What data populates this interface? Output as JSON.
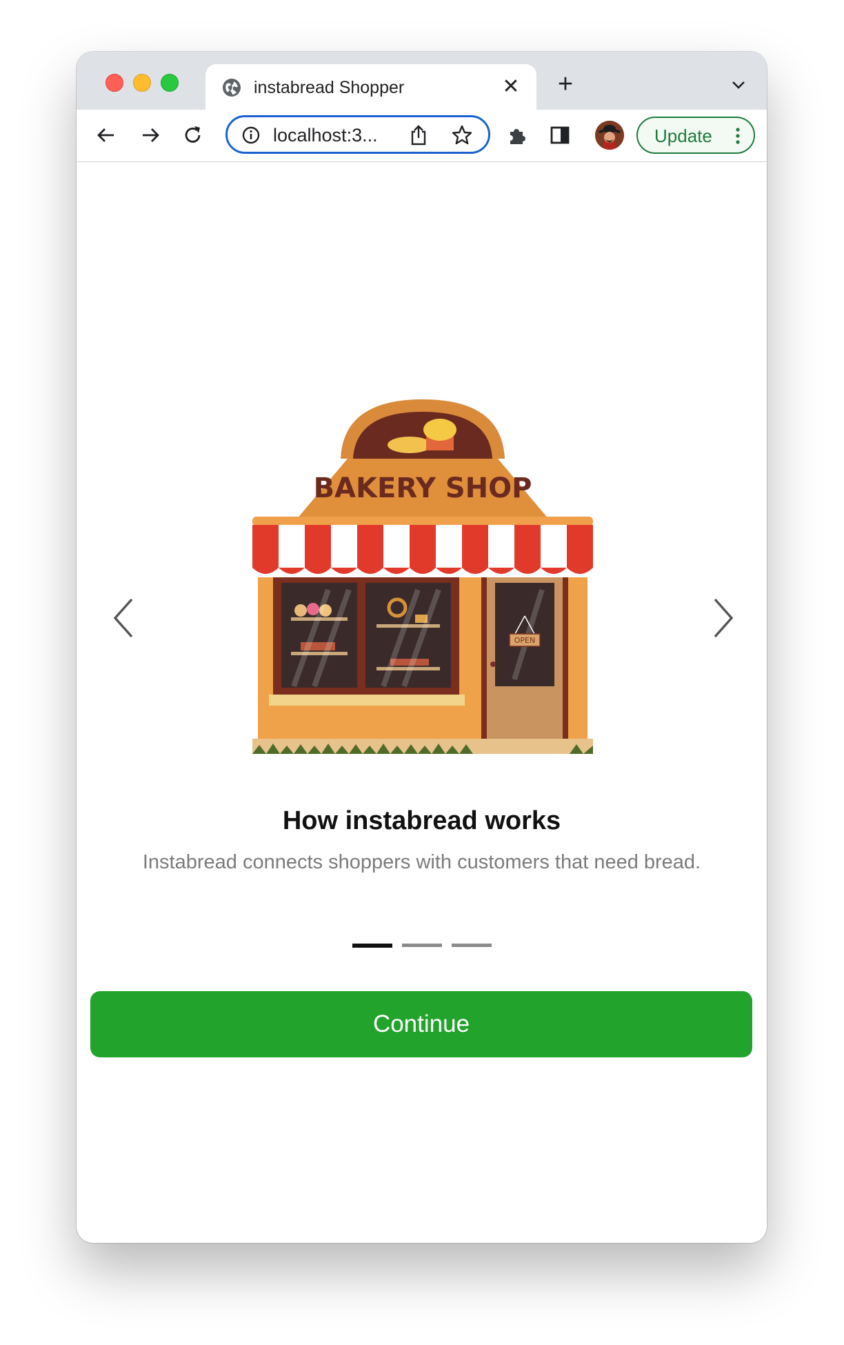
{
  "browser": {
    "tab": {
      "title": "instabread Shopper"
    },
    "address_bar": {
      "url": "localhost:3..."
    },
    "update_button": {
      "label": "Update"
    }
  },
  "onboarding": {
    "illustration": {
      "sign_text": "BAKERY SHOP",
      "door_sign": "OPEN"
    },
    "headline": "How instabread works",
    "description": "Instabread connects shoppers with customers that need bread.",
    "pagination": {
      "total": 3,
      "current": 1
    },
    "continue_label": "Continue"
  },
  "colors": {
    "primary": "#22a32b",
    "focus_ring": "#1a62d1",
    "update_green": "#1e7b3b"
  }
}
